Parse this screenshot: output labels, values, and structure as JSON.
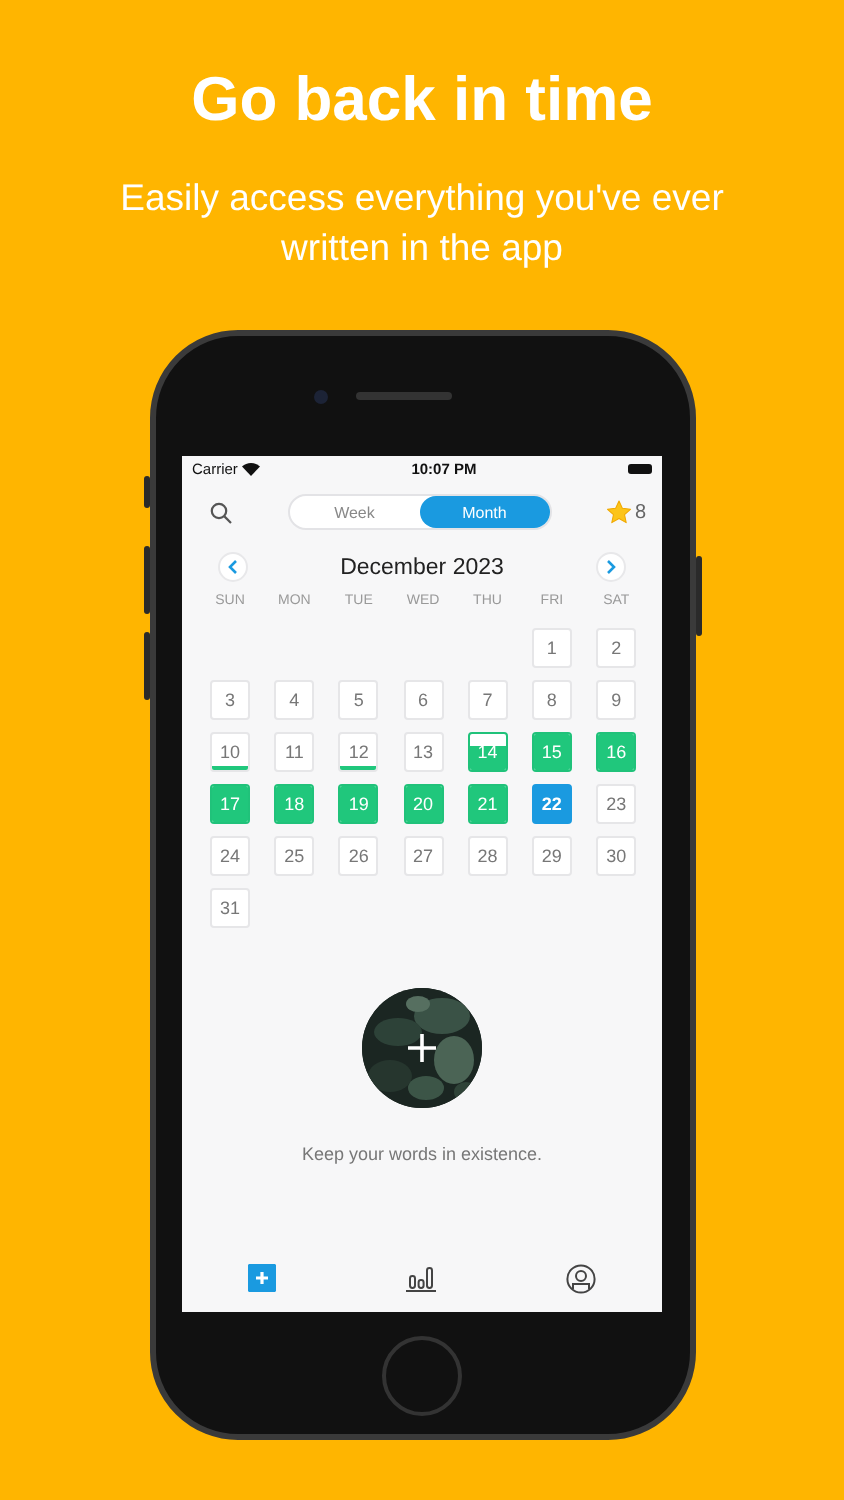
{
  "headline": "Go back in time",
  "subheadline": "Easily access everything you've ever written in the app",
  "status_bar": {
    "carrier": "Carrier",
    "time": "10:07 PM"
  },
  "view_toggle": [
    {
      "label": "Week",
      "selected": false
    },
    {
      "label": "Month",
      "selected": true
    }
  ],
  "stars": {
    "count": "8"
  },
  "calendar": {
    "month": "December 2023",
    "weekdays": [
      "SUN",
      "MON",
      "TUE",
      "WED",
      "THU",
      "FRI",
      "SAT"
    ],
    "weeks": [
      [
        {
          "kind": "blank"
        },
        {
          "kind": "blank"
        },
        {
          "kind": "blank"
        },
        {
          "kind": "blank"
        },
        {
          "kind": "blank"
        },
        {
          "kind": "empty",
          "day": "1",
          "selected": false
        },
        {
          "kind": "empty",
          "day": "2",
          "selected": false
        }
      ],
      [
        {
          "kind": "empty",
          "day": "3",
          "selected": false
        },
        {
          "kind": "empty",
          "day": "4",
          "selected": false
        },
        {
          "kind": "empty",
          "day": "5",
          "selected": false
        },
        {
          "kind": "empty",
          "day": "6",
          "selected": false
        },
        {
          "kind": "empty",
          "day": "7",
          "selected": false
        },
        {
          "kind": "empty",
          "day": "8",
          "selected": false
        },
        {
          "kind": "empty",
          "day": "9",
          "selected": false
        }
      ],
      [
        {
          "kind": "started",
          "day": "10",
          "selected": false
        },
        {
          "kind": "empty",
          "day": "11",
          "selected": false
        },
        {
          "kind": "started",
          "day": "12",
          "selected": false
        },
        {
          "kind": "empty",
          "day": "13",
          "selected": false
        },
        {
          "kind": "partial",
          "day": "14",
          "selected": false
        },
        {
          "kind": "written",
          "day": "15",
          "selected": false
        },
        {
          "kind": "written",
          "day": "16",
          "selected": false
        }
      ],
      [
        {
          "kind": "written",
          "day": "17",
          "selected": false
        },
        {
          "kind": "written",
          "day": "18",
          "selected": false
        },
        {
          "kind": "written",
          "day": "19",
          "selected": false
        },
        {
          "kind": "written",
          "day": "20",
          "selected": false
        },
        {
          "kind": "written",
          "day": "21",
          "selected": false
        },
        {
          "kind": "empty",
          "day": "22",
          "selected": true
        },
        {
          "kind": "empty",
          "day": "23",
          "selected": false
        }
      ],
      [
        {
          "kind": "empty",
          "day": "24",
          "selected": false
        },
        {
          "kind": "empty",
          "day": "25",
          "selected": false
        },
        {
          "kind": "empty",
          "day": "26",
          "selected": false
        },
        {
          "kind": "empty",
          "day": "27",
          "selected": false
        },
        {
          "kind": "empty",
          "day": "28",
          "selected": false
        },
        {
          "kind": "empty",
          "day": "29",
          "selected": false
        },
        {
          "kind": "empty",
          "day": "30",
          "selected": false
        }
      ],
      [
        {
          "kind": "empty",
          "day": "31",
          "selected": false
        }
      ]
    ]
  },
  "empty_state": {
    "caption": "Keep your words in existence."
  },
  "tab_bar": [
    {
      "kind": "add",
      "selected": true
    },
    {
      "kind": "stats",
      "selected": false
    },
    {
      "kind": "profile",
      "selected": false
    }
  ]
}
